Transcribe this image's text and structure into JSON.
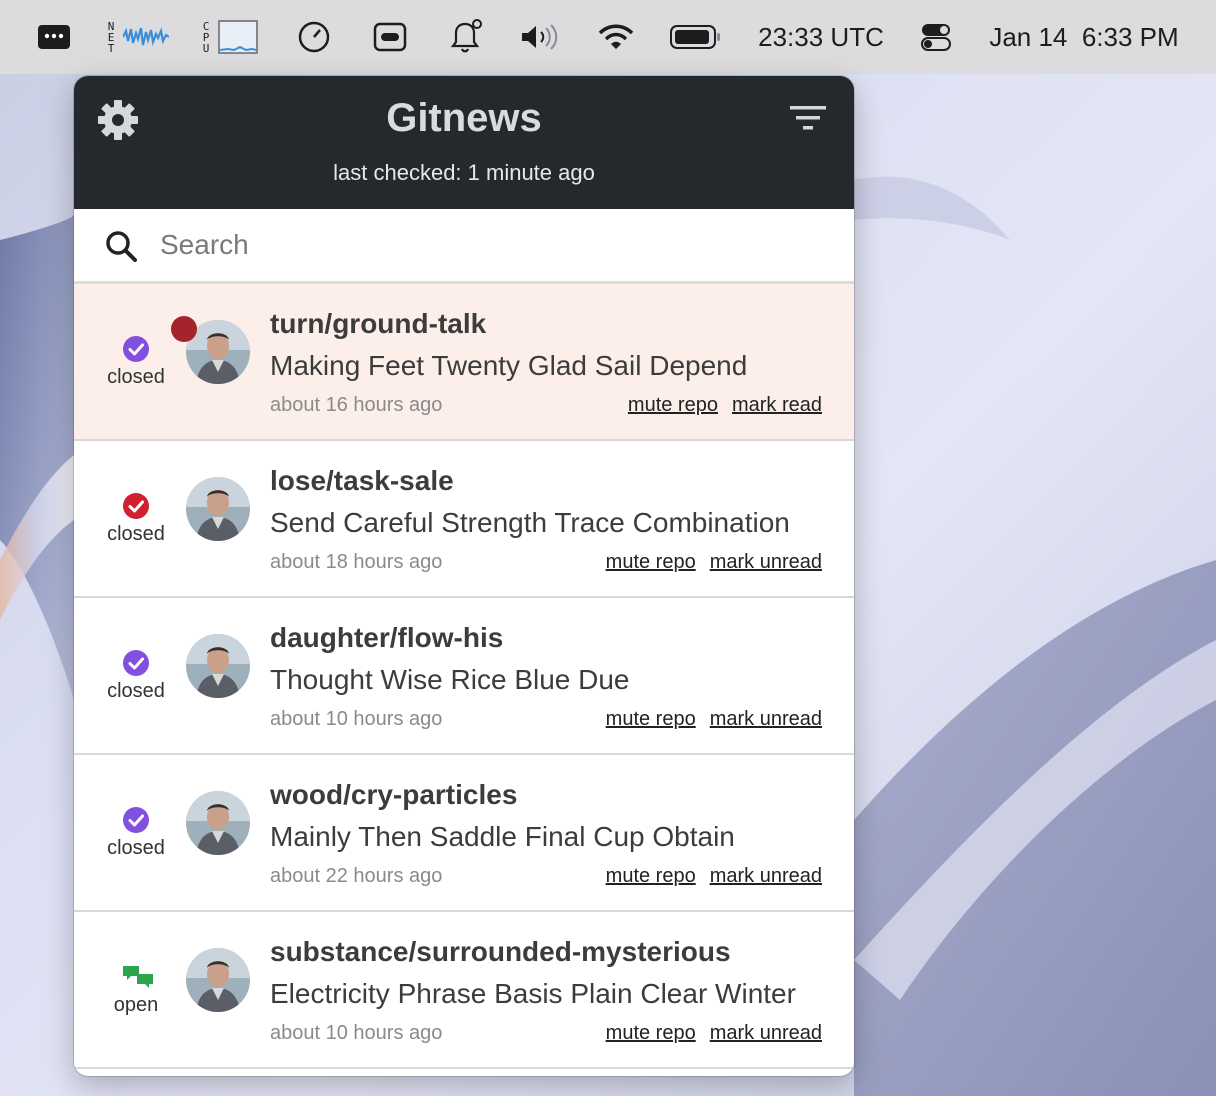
{
  "menubar": {
    "net_label": "NET",
    "cpu_label": "CPU",
    "utc_time": "23:33 UTC",
    "date_time": "Jan 14  6:33 PM",
    "icons": [
      "menu-dots-icon",
      "net-graph-icon",
      "cpu-graph-icon",
      "stopwatch-icon",
      "toggle-app-icon",
      "bell-icon",
      "volume-icon",
      "wifi-icon",
      "battery-icon",
      "control-center-icon"
    ]
  },
  "app": {
    "title": "Gitnews",
    "last_checked": "last checked: 1 minute ago",
    "search_placeholder": "Search"
  },
  "notifications": [
    {
      "status": "closed",
      "status_color": "#8250df",
      "repo": "turn/ground-talk",
      "title": "Making Feet Twenty Glad Sail Depend",
      "time": "about 16 hours ago",
      "mute": "mute repo",
      "mark": "mark read",
      "unread": true
    },
    {
      "status": "closed",
      "status_color": "#cf222e",
      "repo": "lose/task-sale",
      "title": "Send Careful Strength Trace Combination",
      "time": "about 18 hours ago",
      "mute": "mute repo",
      "mark": "mark unread",
      "unread": false
    },
    {
      "status": "closed",
      "status_color": "#8250df",
      "repo": "daughter/flow-his",
      "title": "Thought Wise Rice Blue Due",
      "time": "about 10 hours ago",
      "mute": "mute repo",
      "mark": "mark unread",
      "unread": false
    },
    {
      "status": "closed",
      "status_color": "#8250df",
      "repo": "wood/cry-particles",
      "title": "Mainly Then Saddle Final Cup Obtain",
      "time": "about 22 hours ago",
      "mute": "mute repo",
      "mark": "mark unread",
      "unread": false
    },
    {
      "status": "open",
      "status_color": "#2da44e",
      "repo": "substance/surrounded-mysterious",
      "title": "Electricity Phrase Basis Plain Clear Winter",
      "time": "about 10 hours ago",
      "mute": "mute repo",
      "mark": "mark unread",
      "unread": false
    }
  ]
}
